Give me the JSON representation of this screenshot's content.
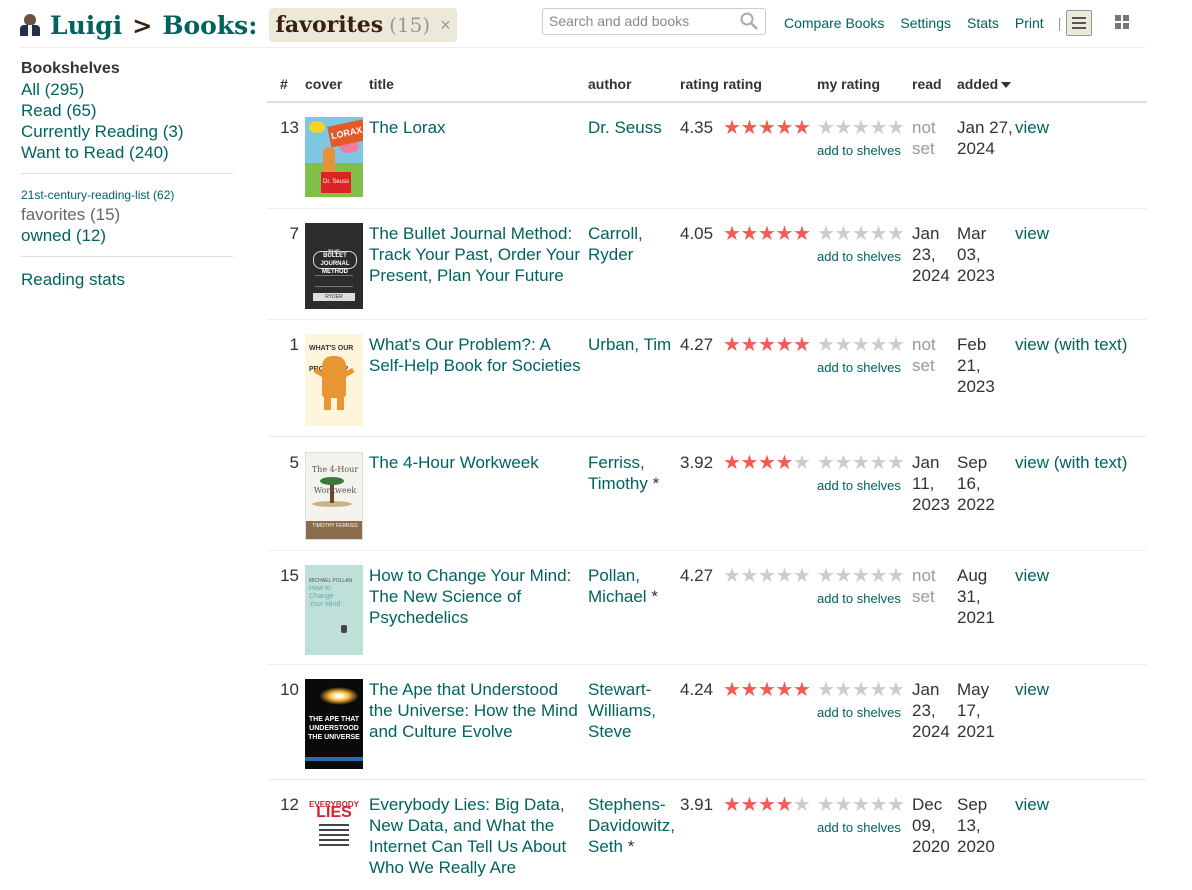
{
  "header": {
    "user": "Luigi",
    "sep": ">",
    "section": "Books:",
    "shelf": "favorites",
    "shelf_count": "(15)",
    "remove": "×"
  },
  "search": {
    "placeholder": "Search and add books"
  },
  "nav": {
    "compare": "Compare Books",
    "settings": "Settings",
    "stats": "Stats",
    "print": "Print",
    "pipe": "|"
  },
  "sidebar": {
    "title": "Bookshelves",
    "shelves": [
      "All (295)",
      "Read (65)",
      "Currently Reading (3)",
      "Want to Read (240)"
    ],
    "custom": "21st-century-reading-list (62)",
    "current": "favorites (15)",
    "owned": "owned (12)",
    "stats": "Reading stats"
  },
  "columns": {
    "num": "#",
    "cover": "cover",
    "title": "title",
    "author": "author",
    "avg": "rating",
    "rating": "rating",
    "my": "my rating",
    "read": "read",
    "added": "added"
  },
  "accent_color": "#00635d",
  "star_color": "#f25c54",
  "add_label": "add to shelves",
  "books": [
    {
      "num": "13",
      "title": "The Lorax",
      "author": "Dr. Seuss",
      "author_star": "",
      "avg": "4.35",
      "stars_filled": 5,
      "read": "not set",
      "added": "Jan 27, 2024",
      "view": "view",
      "cover_text": [
        "LORAX",
        "Dr. Seuss"
      ]
    },
    {
      "num": "7",
      "title": "The Bullet Journal Method: Track Your Past, Order Your Present, Plan Your Future",
      "author": "Carroll, Ryder",
      "author_star": "",
      "avg": "4.05",
      "stars_filled": 5,
      "read": "Jan 23, 2024",
      "added": "Mar 03, 2023",
      "view": "view",
      "cover_text": [
        "THE",
        "BULLET JOURNAL METHOD",
        "RYDER CARROLL"
      ]
    },
    {
      "num": "1",
      "title": "What's Our Problem?: A Self-Help Book for Societies",
      "author": "Urban, Tim",
      "author_star": "",
      "avg": "4.27",
      "stars_filled": 5,
      "read": "not set",
      "added": "Feb 21, 2023",
      "view": "view (with text)",
      "cover_text": [
        "WHAT'S OUR PROBLEM?"
      ]
    },
    {
      "num": "5",
      "title": "The 4-Hour Workweek",
      "author": "Ferriss, Timothy",
      "author_star": "*",
      "avg": "3.92",
      "stars_filled": 4,
      "read": "Jan 11, 2023",
      "added": "Sep 16, 2022",
      "view": "view (with text)",
      "cover_text": [
        "The 4-Hour Workweek",
        "TIMOTHY FERRISS"
      ]
    },
    {
      "num": "15",
      "title": "How to Change Your Mind: The New Science of Psychedelics",
      "author": "Pollan, Michael",
      "author_star": "*",
      "avg": "4.27",
      "stars_filled": 0,
      "read": "not set",
      "added": "Aug 31, 2021",
      "view": "view",
      "cover_text": [
        "MICHAEL POLLAN",
        "How to Change Your Mind"
      ]
    },
    {
      "num": "10",
      "title": "The Ape that Understood the Universe: How the Mind and Culture Evolve",
      "author": "Stewart-Williams, Steve",
      "author_star": "",
      "avg": "4.24",
      "stars_filled": 5,
      "read": "Jan 23, 2024",
      "added": "May 17, 2021",
      "view": "view",
      "cover_text": [
        "THE APE THAT",
        "UNDERSTOOD",
        "THE UNIVERSE"
      ]
    },
    {
      "num": "12",
      "title": "Everybody Lies: Big Data, New Data, and What the Internet Can Tell Us About Who We Really Are",
      "author": "Stephens-Davidowitz, Seth",
      "author_star": "*",
      "avg": "3.91",
      "stars_filled": 4,
      "read": "Dec 09, 2020",
      "added": "Sep 13, 2020",
      "view": "view",
      "cover_text": [
        "EVERYBODY",
        "LIES"
      ]
    }
  ]
}
